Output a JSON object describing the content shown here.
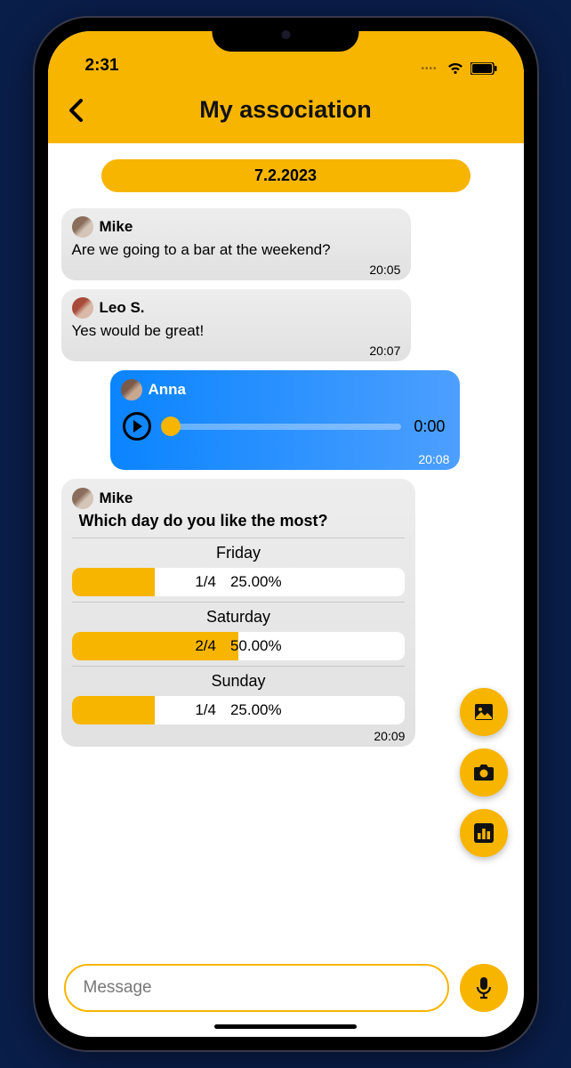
{
  "status": {
    "time": "2:31"
  },
  "header": {
    "title": "My association"
  },
  "chat": {
    "date": "7.2.2023",
    "messages": [
      {
        "sender": "Mike",
        "text": "Are we going to a bar at the weekend?",
        "time": "20:05"
      },
      {
        "sender": "Leo S.",
        "text": "Yes would be great!",
        "time": "20:07"
      }
    ],
    "voice": {
      "sender": "Anna",
      "duration": "0:00",
      "time": "20:08"
    },
    "poll": {
      "sender": "Mike",
      "question": "Which day do you like the most?",
      "options": [
        {
          "label": "Friday",
          "ratio": "1/4",
          "percent": "25.00%",
          "width": 25
        },
        {
          "label": "Saturday",
          "ratio": "2/4",
          "percent": "50.00%",
          "width": 50
        },
        {
          "label": "Sunday",
          "ratio": "1/4",
          "percent": "25.00%",
          "width": 25
        }
      ],
      "time": "20:09"
    }
  },
  "input": {
    "placeholder": "Message"
  }
}
